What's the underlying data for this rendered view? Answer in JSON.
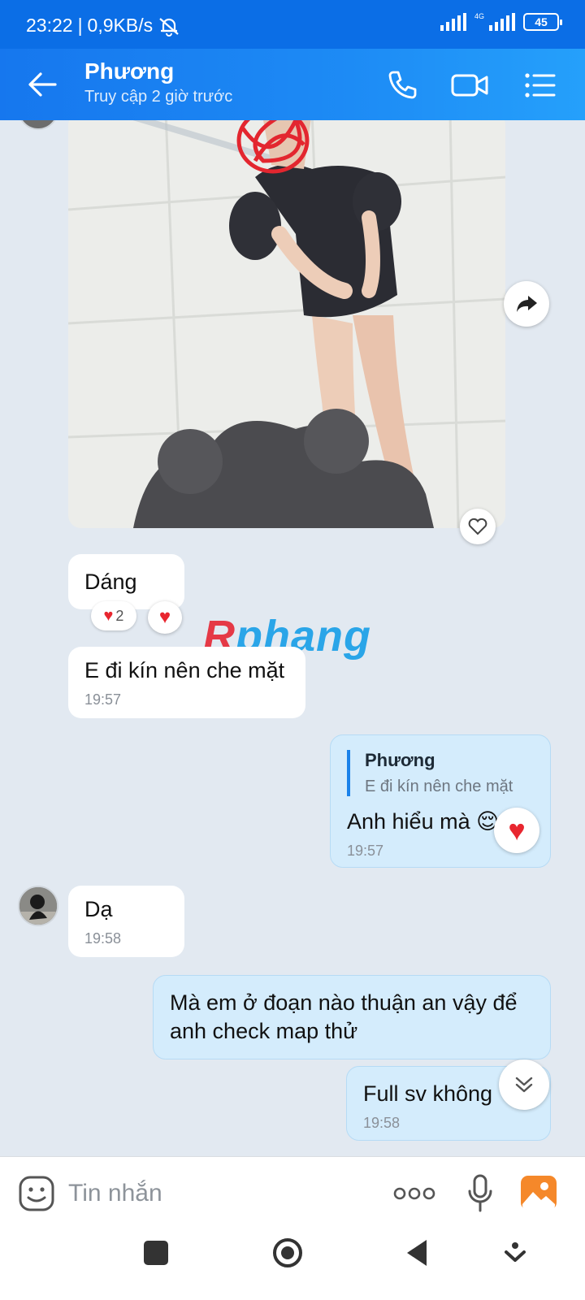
{
  "status_bar": {
    "time": "23:22",
    "speed": "0,9KB/s",
    "network": "4G",
    "battery": "45"
  },
  "header": {
    "contact_name": "Phương",
    "contact_status": "Truy cập 2 giờ trước"
  },
  "messages": [
    {
      "id": "m1",
      "type": "image",
      "direction": "in"
    },
    {
      "id": "m2",
      "direction": "in",
      "text": "Dáng",
      "reaction_count": "2"
    },
    {
      "id": "m3",
      "direction": "in",
      "text": "E đi kín nên che mặt",
      "time": "19:57"
    },
    {
      "id": "m4",
      "direction": "out",
      "reply_to_name": "Phương",
      "reply_to_text": "E đi kín nên che mặt",
      "text": "Anh hiểu mà 😌",
      "time": "19:57"
    },
    {
      "id": "m5",
      "direction": "in",
      "text": "Dạ",
      "time": "19:58"
    },
    {
      "id": "m6",
      "direction": "out",
      "text": "Mà em ở đoạn nào thuận an vậy để anh check map thử"
    },
    {
      "id": "m7",
      "direction": "out",
      "text": "Full sv không",
      "time": "19:58"
    }
  ],
  "watermark": {
    "part1": "R",
    "part2": "phang"
  },
  "input": {
    "placeholder": "Tin nhắn"
  },
  "colors": {
    "header_blue": "#1677ee",
    "status_blue": "#0b6ee6",
    "chat_bg": "#e2e9f1",
    "outgoing_bubble": "#d4ecfc",
    "heart_red": "#e8262f"
  },
  "icons": [
    "back-arrow-icon",
    "phone-icon",
    "video-call-icon",
    "menu-list-icon",
    "share-icon",
    "heart-outline-icon",
    "heart-icon",
    "scroll-down-icon",
    "sticker-icon",
    "more-icon",
    "microphone-icon",
    "image-icon",
    "recent-apps-icon",
    "home-icon",
    "back-nav-icon",
    "nav-down-icon",
    "mute-bell-icon"
  ]
}
